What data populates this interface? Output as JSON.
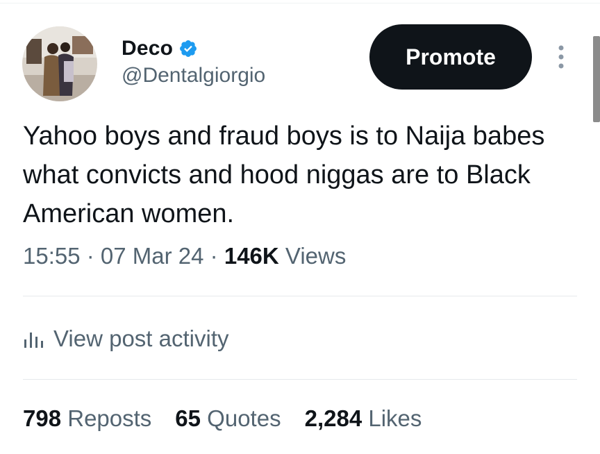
{
  "author": {
    "display_name": "Deco",
    "handle": "@Dentalgiorgio",
    "verified": true,
    "verified_color": "#1d9bf0"
  },
  "actions": {
    "promote_label": "Promote",
    "more_icon": "more-vertical-icon"
  },
  "tweet": {
    "text": "Yahoo boys and fraud boys is to Naija babes what convicts and hood niggas are to Black American women."
  },
  "meta": {
    "time": "15:55",
    "separator": " · ",
    "date": "07 Mar 24",
    "views_count": "146K",
    "views_label": " Views"
  },
  "activity": {
    "icon": "analytics-icon",
    "label": "View post activity"
  },
  "stats": {
    "reposts_count": "798",
    "reposts_label": " Reposts",
    "quotes_count": "65",
    "quotes_label": " Quotes",
    "likes_count": "2,284",
    "likes_label": " Likes"
  },
  "colors": {
    "text_primary": "#0f1419",
    "text_secondary": "#536471",
    "button_bg": "#0f1419"
  }
}
